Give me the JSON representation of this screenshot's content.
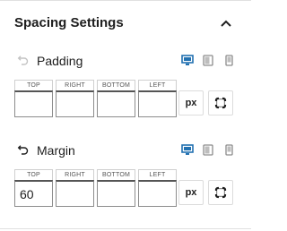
{
  "panel": {
    "title": "Spacing Settings"
  },
  "colors": {
    "accent": "#2271b1",
    "device_inactive": "#8c8c8c",
    "text": "#1e1e1e"
  },
  "padding": {
    "label": "Padding",
    "reset_enabled": false,
    "active_device": "desktop",
    "fields": [
      {
        "label": "TOP",
        "value": ""
      },
      {
        "label": "RIGHT",
        "value": ""
      },
      {
        "label": "BOTTOM",
        "value": ""
      },
      {
        "label": "LEFT",
        "value": ""
      }
    ],
    "unit": "px",
    "link_icon": "link-values-icon"
  },
  "margin": {
    "label": "Margin",
    "reset_enabled": true,
    "active_device": "desktop",
    "fields": [
      {
        "label": "TOP",
        "value": "60"
      },
      {
        "label": "RIGHT",
        "value": ""
      },
      {
        "label": "BOTTOM",
        "value": ""
      },
      {
        "label": "LEFT",
        "value": ""
      }
    ],
    "unit": "px",
    "link_icon": "link-values-icon"
  },
  "icons": {
    "collapse": "chevron-up-icon",
    "reset": "reset-arrow-icon",
    "devices": [
      "desktop-icon",
      "tablet-icon",
      "mobile-icon"
    ]
  }
}
